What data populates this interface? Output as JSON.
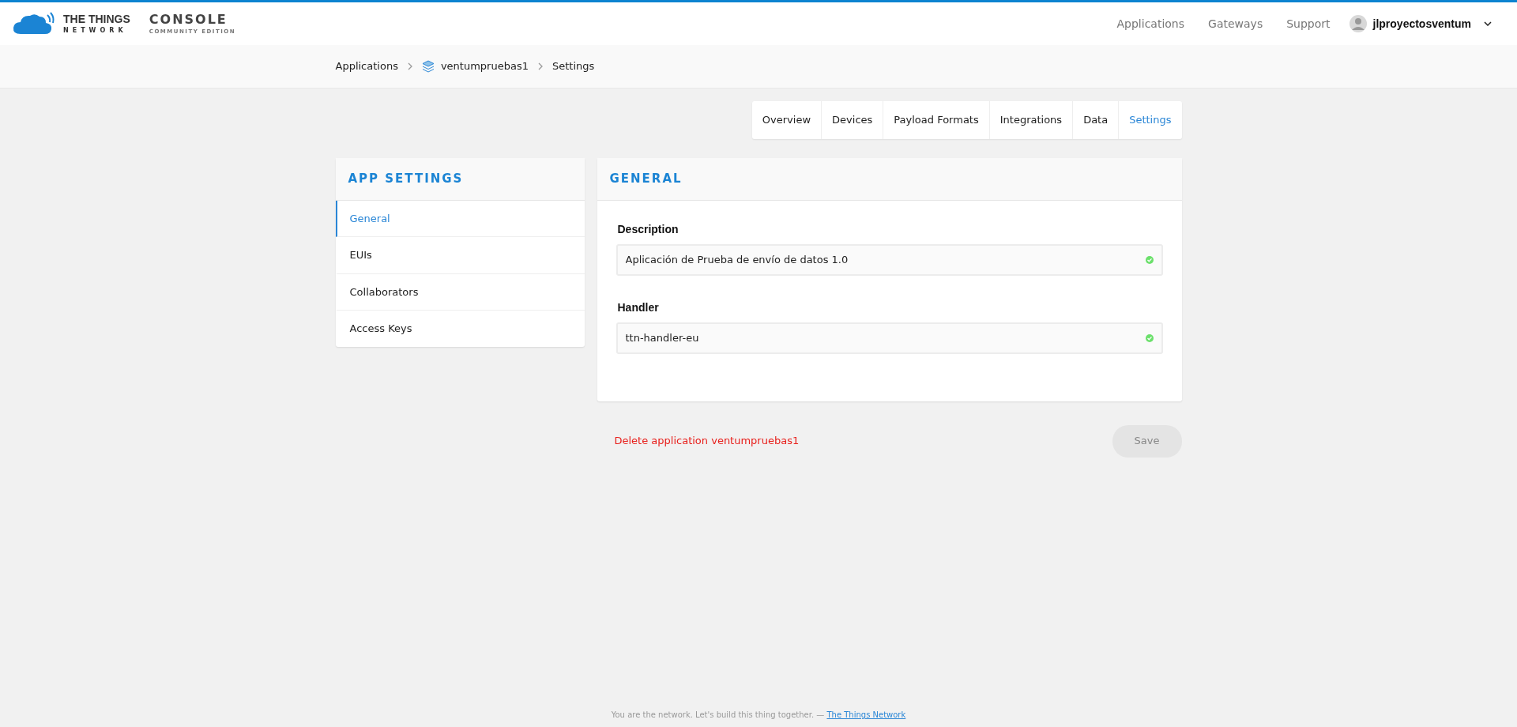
{
  "brand": {
    "name_top": "THE THINGS",
    "name_bottom": "NETWORK",
    "product": "CONSOLE",
    "edition": "COMMUNITY EDITION"
  },
  "top_nav": [
    {
      "label": "Applications"
    },
    {
      "label": "Gateways"
    },
    {
      "label": "Support"
    }
  ],
  "user": {
    "name": "jlproyectosventum"
  },
  "breadcrumb": [
    {
      "label": "Applications",
      "kind": "link"
    },
    {
      "label": "ventumpruebas1",
      "kind": "app"
    },
    {
      "label": "Settings",
      "kind": "current"
    }
  ],
  "tabs": [
    {
      "label": "Overview",
      "selected": false
    },
    {
      "label": "Devices",
      "selected": false
    },
    {
      "label": "Payload Formats",
      "selected": false
    },
    {
      "label": "Integrations",
      "selected": false
    },
    {
      "label": "Data",
      "selected": false
    },
    {
      "label": "Settings",
      "selected": true
    }
  ],
  "sidebar": {
    "title": "APP SETTINGS",
    "items": [
      {
        "label": "General",
        "selected": true
      },
      {
        "label": "EUIs",
        "selected": false
      },
      {
        "label": "Collaborators",
        "selected": false
      },
      {
        "label": "Access Keys",
        "selected": false
      }
    ]
  },
  "panel": {
    "title": "GENERAL",
    "fields": [
      {
        "label": "Description",
        "value": "Aplicación de Prueba de envío de datos 1.0",
        "valid": true
      },
      {
        "label": "Handler",
        "value": "ttn-handler-eu",
        "valid": true
      }
    ]
  },
  "delete_link": "Delete application ventumpruebas1",
  "save_button": {
    "label": "Save",
    "disabled": true
  },
  "footer": {
    "text": "You are the network. Let's build this thing together. —",
    "link": "The Things Network"
  }
}
